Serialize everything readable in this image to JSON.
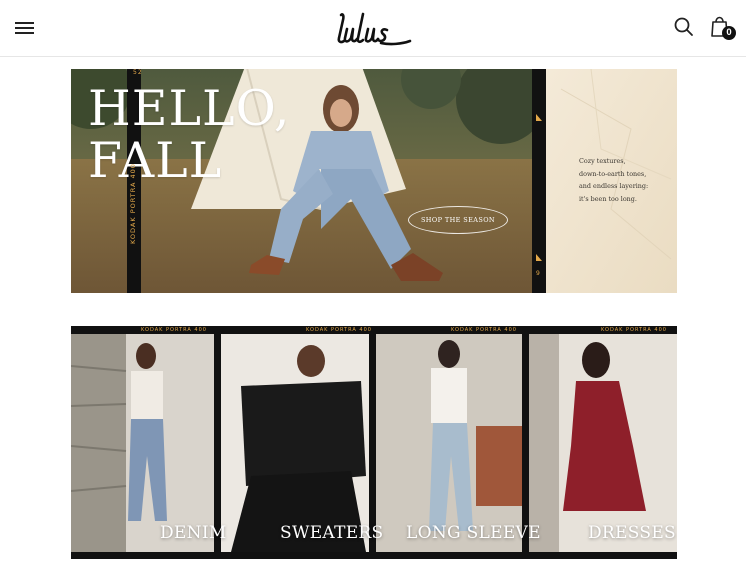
{
  "header": {
    "menu_icon": "hamburger-menu-icon",
    "logo_text": "Lulus",
    "search_icon": "search-icon",
    "cart_icon": "shopping-bag-icon",
    "cart_count": "0"
  },
  "hero": {
    "title": "HELLO,\nFALL",
    "copy": "Cozy textures,\ndown-to-earth tones,\nand endless layering:\nit's been too long.",
    "cta": "SHOP THE SEASON",
    "film_text": "KODAK PORTRA 400",
    "frame_number_top": "52",
    "frame_number_bottom": "9"
  },
  "categories": {
    "film_text": "KODAK PORTRA 400",
    "items": [
      {
        "label": "DENIM",
        "color": "#7f96b5"
      },
      {
        "label": "SWEATERS",
        "color": "#1a1a1a"
      },
      {
        "label": "LONG SLEEVE",
        "color": "#f4f1ec"
      },
      {
        "label": "DRESSES",
        "color": "#8e1f2a"
      }
    ]
  },
  "colors": {
    "brand_black": "#111111",
    "film_orange": "#e4a94a",
    "hero_paper": "#f1e5d0",
    "header_border": "#e6e6e6"
  }
}
